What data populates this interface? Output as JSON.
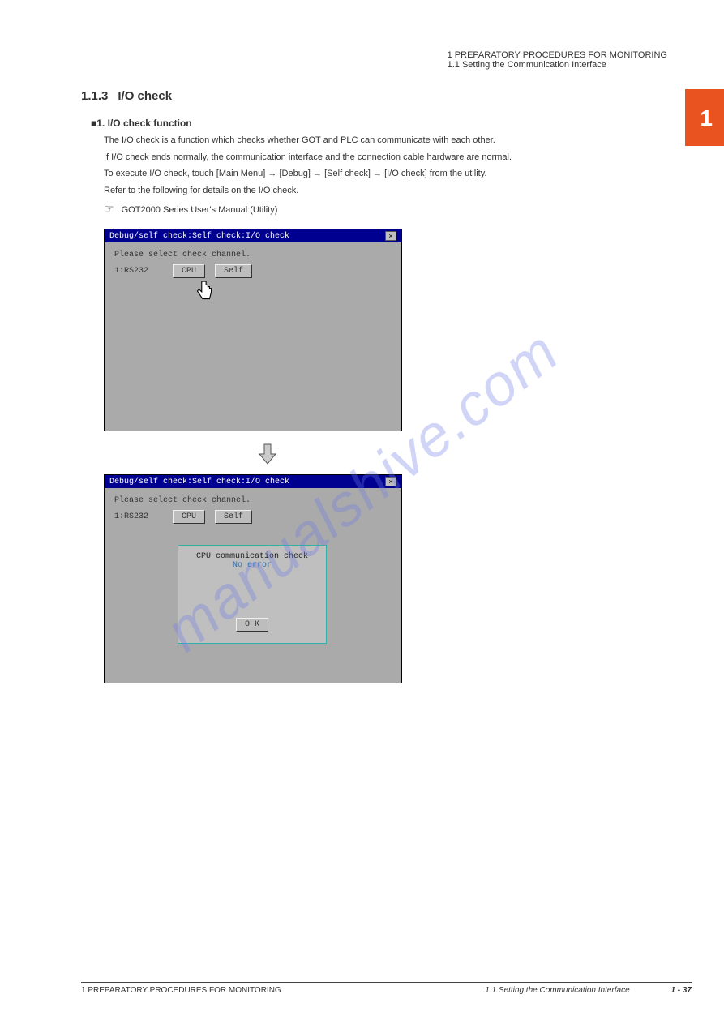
{
  "tab": {
    "number": "1"
  },
  "header": {
    "chapter_line1": "1  PREPARATORY PROCEDURES FOR MONITORING",
    "chapter_line2": "1.1  Setting the Communication Interface"
  },
  "section": {
    "number": "1.1.3",
    "title": "I/O check"
  },
  "intro": {
    "square": "■1.",
    "heading": "I/O check function",
    "p1": "The I/O check is a function which checks whether GOT and PLC can communicate with each other.",
    "p2": "If I/O check ends normally, the communication interface and the connection cable hardware are normal.",
    "p3_prefix": "To execute I/O check, touch [Main Menu]",
    "arrow": "→",
    "p3_mid1": "[Self check]",
    "p3_mid2": "[I/O check] from the utility.",
    "p4": "Refer to the following for details on the I/O check.",
    "p5_prefix": "GOT2000 Series User's Manual (Utility)",
    "nav_tokens": {
      "main_menu": "[Main Menu]",
      "self_check": "[Self check]",
      "io_check": "[I/O check]",
      "debug": "[Debug]",
      "self_check2": "[Self check]"
    },
    "hand_icon": "☞"
  },
  "screen1": {
    "title": "Debug/self check:Self check:I/O check",
    "text_line": "Please select check channel.",
    "label": "1:RS232",
    "btn_cpu": "CPU",
    "btn_self": "Self"
  },
  "screen2": {
    "title": "Debug/self check:Self check:I/O check",
    "text_line": "Please select check channel.",
    "label": "1:RS232",
    "btn_cpu": "CPU",
    "btn_self": "Self",
    "popup_line1": "CPU communication check",
    "popup_line2": "No error",
    "btn_ok": "O K"
  },
  "footer": {
    "left": "1  PREPARATORY PROCEDURES FOR MONITORING",
    "right_prefix": "1.1  Setting the Communication Interface",
    "page": "1 - 37"
  },
  "watermark": "manualshive.com"
}
